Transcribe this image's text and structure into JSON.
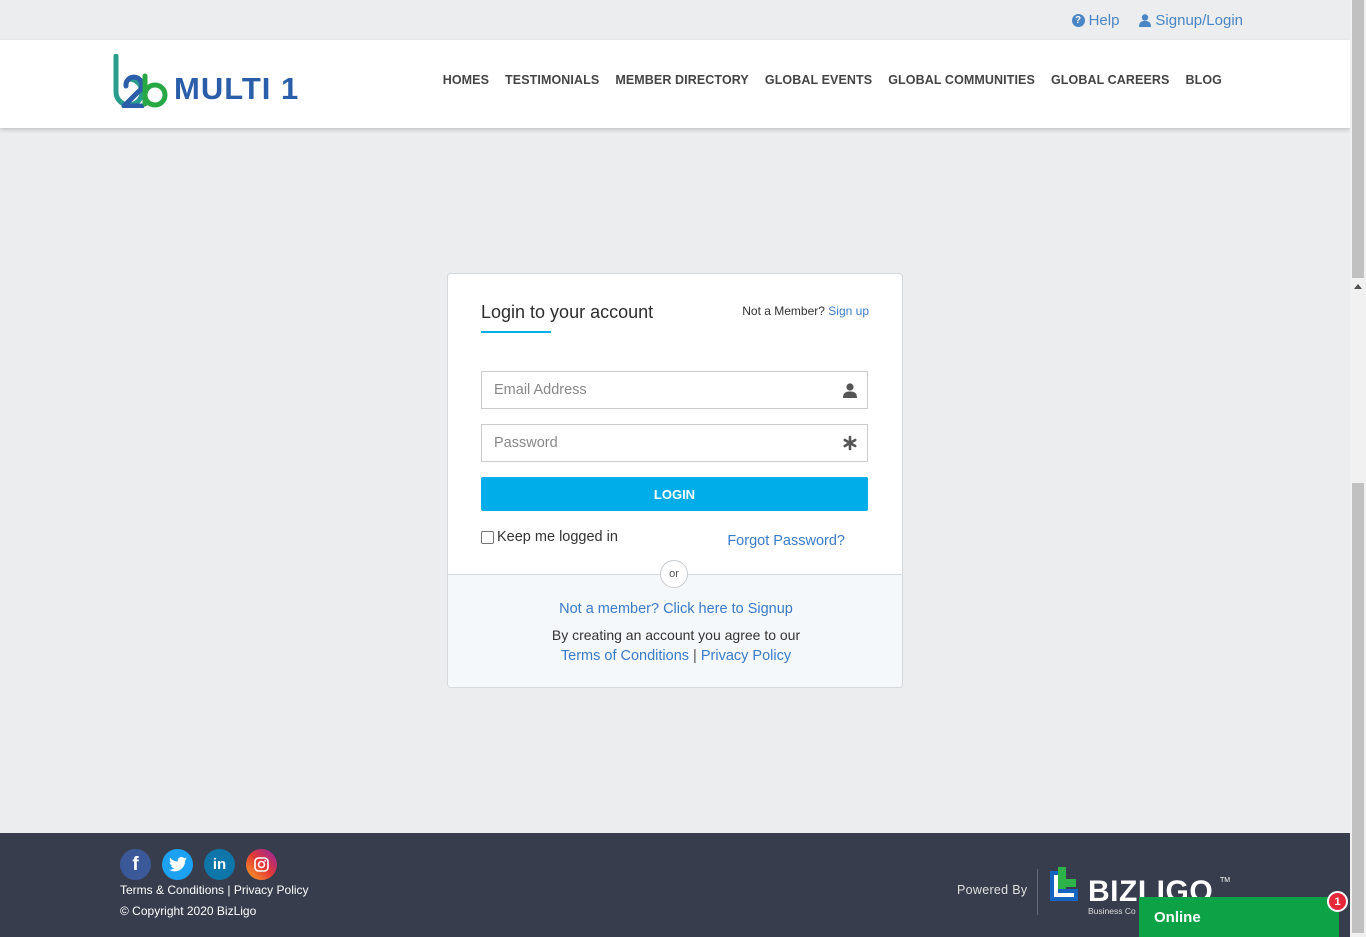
{
  "topbar": {
    "help_label": "Help",
    "signup_login_label": "Signup/Login"
  },
  "header": {
    "logo_mark": "b2b",
    "logo_text": "MULTI 1",
    "nav": [
      "HOMES",
      "TESTIMONIALS",
      "MEMBER DIRECTORY",
      "GLOBAL EVENTS",
      "GLOBAL COMMUNITIES",
      "GLOBAL CAREERS",
      "BLOG"
    ]
  },
  "login": {
    "title": "Login to your account",
    "not_member_text": "Not a Member?",
    "sign_up_link": "Sign up",
    "email_placeholder": "Email Address",
    "password_placeholder": "Password",
    "login_button": "LOGIN",
    "keep_logged_in": "Keep me logged in",
    "forgot_password": "Forgot Password?",
    "or_label": "or",
    "signup_cta": "Not a member? Click here to Signup",
    "agree_text": "By creating an account you agree to our",
    "terms_link": "Terms of Conditions",
    "separator": "|",
    "privacy_link": "Privacy Policy"
  },
  "footer": {
    "terms_link": "Terms & Conditions",
    "separator": " | ",
    "privacy_link": "Privacy Policy",
    "copyright": "© Copyright 2020 BizLigo",
    "powered_by": "Powered By",
    "brand_name": "BIZLIGO",
    "brand_tm": "TM",
    "brand_sub": "Business Co",
    "socials": [
      "facebook-icon",
      "twitter-icon",
      "linkedin-icon",
      "instagram-icon"
    ]
  },
  "chat": {
    "status_label": "Online",
    "badge_count": "1"
  },
  "colors": {
    "accent": "#00ade8",
    "link": "#3a7bc8",
    "footer_bg": "#373d4d",
    "chat_green": "#0ca246",
    "badge_red": "#e5283a"
  }
}
